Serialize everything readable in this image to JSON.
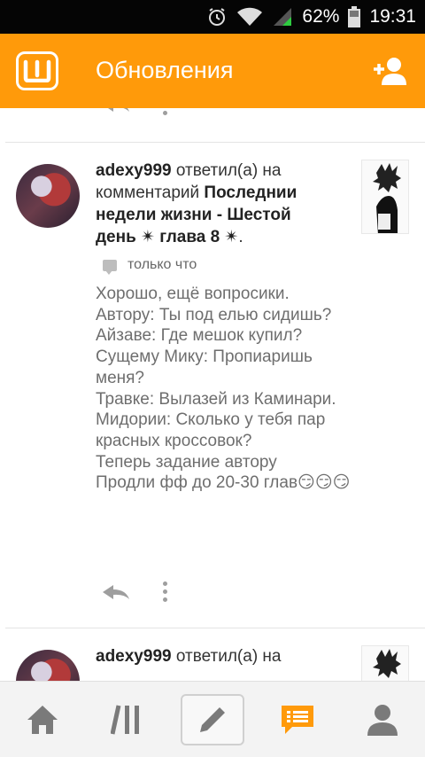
{
  "status_bar": {
    "battery": "62%",
    "time": "19:31",
    "icons": [
      "alarm-icon",
      "wifi-icon",
      "signal-icon",
      "battery-icon"
    ]
  },
  "app_bar": {
    "logo_icon": "wattpad-logo-icon",
    "title": "Обновления",
    "action_icon": "add-user-icon"
  },
  "notifications": [
    {
      "user": "adexy999",
      "action": "ответил(а) на комментарий",
      "story": "Последнии недели жизни - Шестой день ✴ глава 8 ✴",
      "time": "только что",
      "comment": "Хорошо, ещё вопросики.\nАвтору: Ты под елью сидишь?\nАйзаве: Где мешок купил?\nСущему Мику: Пропиаришь меня?\nТравке: Вылазей из Каминари.\nМидории: Сколько у тебя пар красных кроссовок?\nТеперь задание автору\nПродли фф до 20-30 глав😏😏😏"
    },
    {
      "user": "adexy999",
      "action": "ответил(а) на"
    }
  ],
  "bottom_nav": [
    "home-icon",
    "library-icon",
    "write-icon",
    "notifications-icon",
    "profile-icon"
  ],
  "colors": {
    "accent": "#ff9a0a",
    "status_bar": "#050505"
  }
}
